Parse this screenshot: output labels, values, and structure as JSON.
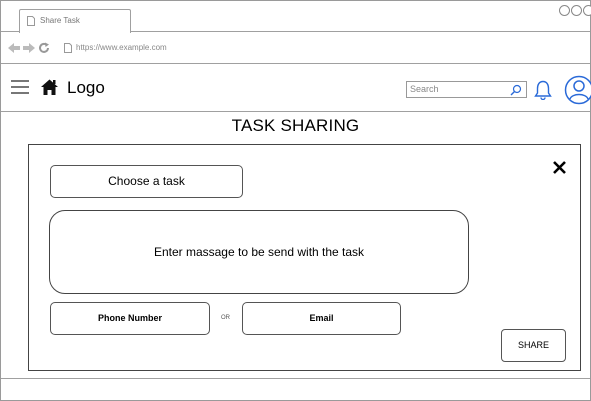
{
  "browser": {
    "tab_title": "Share Task",
    "url": "https://www.example.com"
  },
  "header": {
    "logo": "Logo",
    "search_placeholder": "Search"
  },
  "page": {
    "title": "TASK SHARING"
  },
  "modal": {
    "choose_task_label": "Choose a task",
    "message_placeholder": "Enter massage to be send with the task",
    "phone_label": "Phone Number",
    "or_label": "OR",
    "email_label": "Email",
    "share_label": "SHARE"
  },
  "icons": {
    "close": "close-icon",
    "home": "home-icon",
    "menu": "hamburger-icon",
    "search": "search-icon",
    "bell": "bell-icon",
    "user": "user-icon"
  }
}
